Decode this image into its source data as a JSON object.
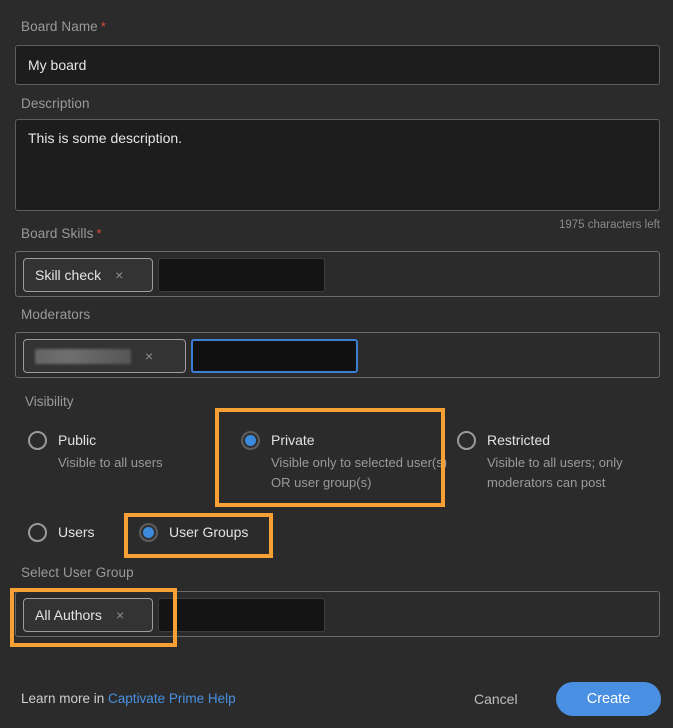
{
  "form": {
    "board_name": {
      "label": "Board Name",
      "required_marker": "*",
      "value": "My board"
    },
    "description": {
      "label": "Description",
      "value": "This is some description.",
      "characters_left": "1975 characters left"
    },
    "board_skills": {
      "label": "Board Skills",
      "required_marker": "*",
      "chips": [
        {
          "label": "Skill check",
          "remove_icon": "×"
        }
      ]
    },
    "moderators": {
      "label": "Moderators",
      "chips": [
        {
          "label": "",
          "redacted": true,
          "remove_icon": "×"
        }
      ]
    },
    "visibility": {
      "label": "Visibility",
      "selected": "Private",
      "options": [
        {
          "title": "Public",
          "desc": "Visible to all users",
          "checked": false
        },
        {
          "title": "Private",
          "desc": "Visible only to selected user(s) OR user group(s)",
          "checked": true
        },
        {
          "title": "Restricted",
          "desc": "Visible to all users; only moderators can post",
          "checked": false
        }
      ]
    },
    "audience": {
      "selected": "User Groups",
      "options": [
        {
          "title": "Users",
          "checked": false
        },
        {
          "title": "User Groups",
          "checked": true
        }
      ]
    },
    "select_user_group": {
      "label": "Select User Group",
      "chips": [
        {
          "label": "All Authors",
          "remove_icon": "×"
        }
      ]
    }
  },
  "footer": {
    "note_prefix": "Learn more in ",
    "link_text": "Captivate Prime Help",
    "cancel_label": "Cancel",
    "create_label": "Create"
  },
  "colors": {
    "page_background": "#2b2b2b",
    "input_background": "#1d1d1d",
    "accent_blue": "#4a90e2",
    "highlight_orange": "#f7a035",
    "required_red": "#e04a3f"
  }
}
